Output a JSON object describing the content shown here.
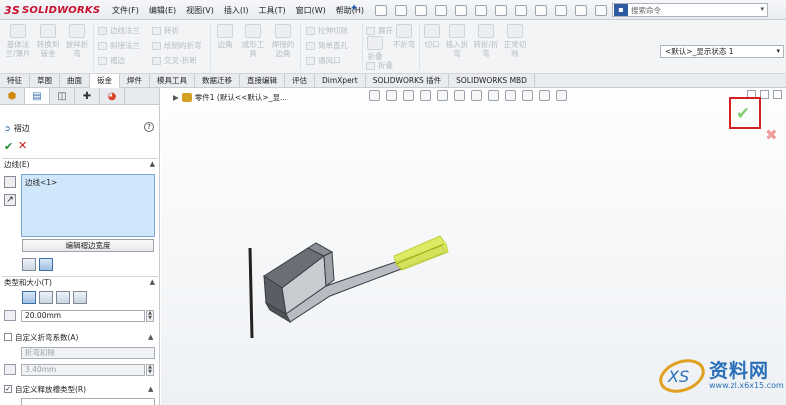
{
  "app": {
    "logo": "SOLIDWORKS",
    "logo_prefix": "3S"
  },
  "menu": [
    "文件(F)",
    "编辑(E)",
    "视图(V)",
    "插入(I)",
    "工具(T)",
    "窗口(W)",
    "帮助(H)"
  ],
  "search": {
    "placeholder": "搜索命令"
  },
  "ribbon": {
    "big": [
      "基体法兰/薄片",
      "转换到钣金",
      "放样折弯",
      "成形工具",
      "拉伸切除",
      "简单直孔",
      "展开",
      "折叠",
      "不折弯",
      "边角",
      "切口",
      "插入折弯",
      "转折/折弯",
      "正常切除",
      "焊接的边角"
    ],
    "small": [
      "边线法兰",
      "斜接法兰",
      "褶边",
      "转折",
      "绘制的折弯",
      "交叉-折断",
      "通风口",
      "展开",
      "折叠",
      "焊接"
    ]
  },
  "config": {
    "value": "<默认>_显示状态 1"
  },
  "tabs": [
    "特征",
    "草图",
    "曲面",
    "钣金",
    "焊件",
    "模具工具",
    "数据迁移",
    "直接编辑",
    "评估",
    "DimXpert",
    "SOLIDWORKS 插件",
    "SOLIDWORKS MBD"
  ],
  "pm": {
    "title": "褶边",
    "help": "?",
    "sections": {
      "edges": "边线(E)",
      "type_size": "类型和大小(T)",
      "custom_bend": "自定义折弯系数(A)",
      "custom_relief": "自定义释放槽类型(R)"
    },
    "edge_list": [
      "边线<1>"
    ],
    "edit_button": "编辑褶边宽度",
    "length": "20.00mm",
    "bend_option": "折弯扣除",
    "bend_value": "3.40mm"
  },
  "graphics": {
    "breadcrumb": "零件1 (默认<<默认>_显..."
  },
  "watermark": {
    "text": "资料网",
    "url": "www.zl.x6x15.com"
  }
}
